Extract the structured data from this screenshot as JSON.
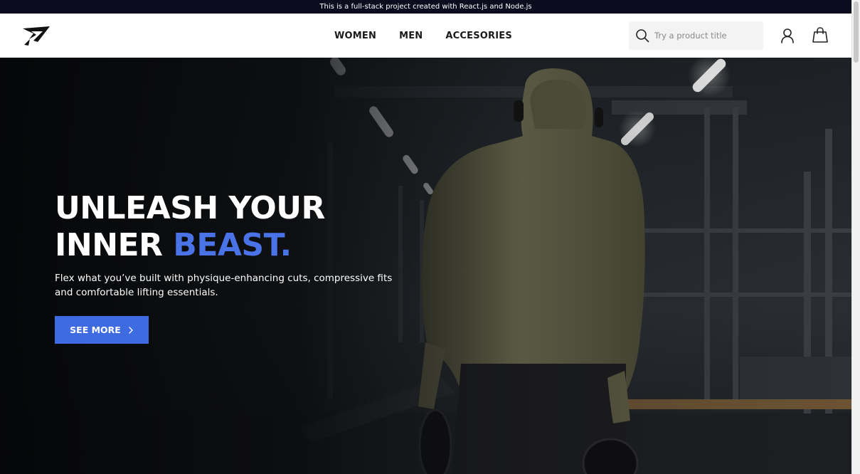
{
  "announcement": {
    "text": "This is a full-stack project created with React.js and Node.js"
  },
  "header": {
    "logo_icon": "gymshark-logo-icon",
    "nav": [
      {
        "label": "WOMEN"
      },
      {
        "label": "MEN"
      },
      {
        "label": "ACCESORIES"
      }
    ],
    "search": {
      "placeholder": "Try a product title",
      "value": "",
      "icon": "search-icon"
    },
    "account_icon": "user-icon",
    "cart_icon": "shopping-bag-icon"
  },
  "hero": {
    "title_line1": "UNLEASH YOUR",
    "title_line2_plain": "INNER ",
    "title_line2_accent": "BEAST.",
    "subtitle": "Flex what you’ve built with physique-enhancing cuts, compressive fits and comfortable lifting essentials.",
    "cta_label": "SEE MORE",
    "cta_icon": "chevron-right-icon",
    "background": "gym-photo-man-in-hoodie-carrying-weight-plates"
  },
  "colors": {
    "announcement_bg": "#0b0d1e",
    "accent": "#4a73e8",
    "cta_bg": "#3e6be0",
    "nav_text": "#1a1a1a",
    "search_bg": "#f3f3f3"
  }
}
